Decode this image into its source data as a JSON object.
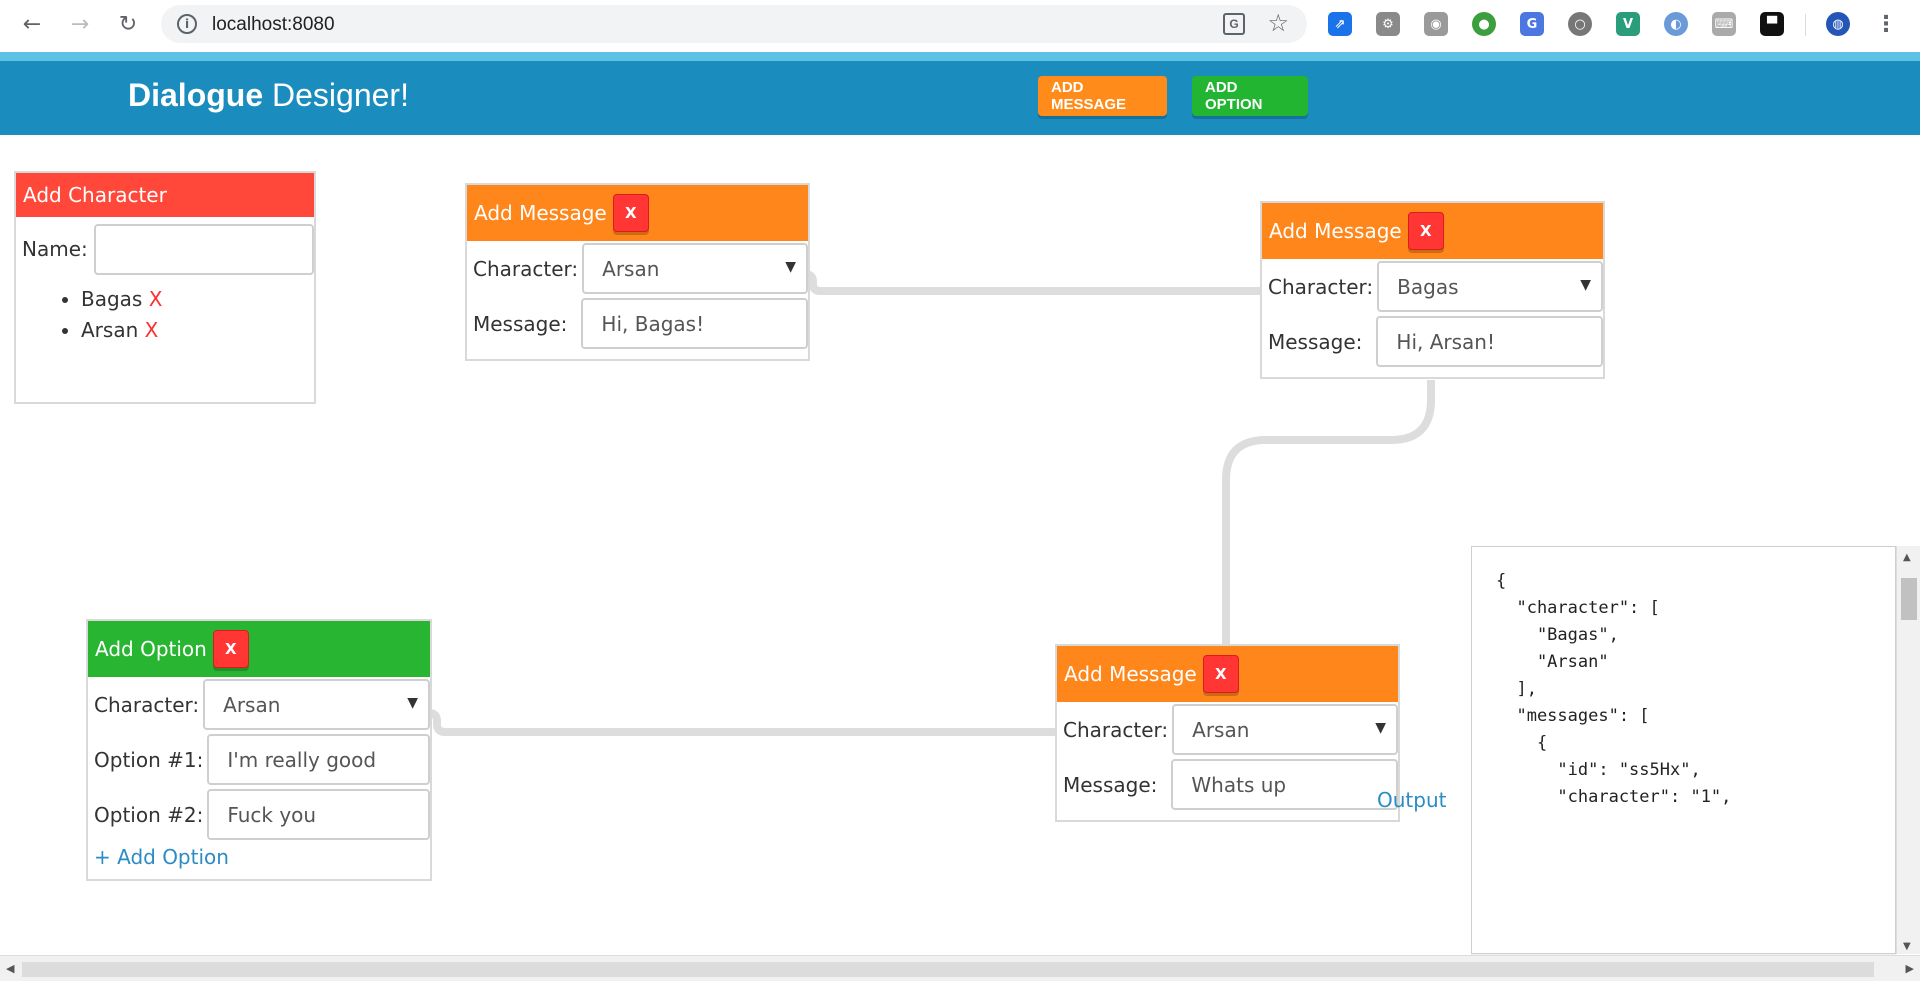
{
  "browser": {
    "url": "localhost:8080",
    "translate_icon": "translate-icon",
    "star_icon": "bookmark-star-icon"
  },
  "header": {
    "title_bold": "Dialogue",
    "title_rest": " Designer!",
    "add_message_label": "ADD MESSAGE",
    "add_option_label": "ADD OPTION"
  },
  "character_panel": {
    "title": "Add Character",
    "name_label": "Name:",
    "name_value": "",
    "characters": [
      "Bagas",
      "Arsan"
    ],
    "delete_label": "X"
  },
  "nodes": {
    "close_label": "X",
    "message1": {
      "title": "Add Message",
      "character_label": "Character:",
      "character": "Arsan",
      "message_label": "Message:",
      "message": "Hi, Bagas!"
    },
    "message2": {
      "title": "Add Message",
      "character_label": "Character:",
      "character": "Bagas",
      "message_label": "Message:",
      "message": "Hi,  Arsan!"
    },
    "message3": {
      "title": "Add Message",
      "character_label": "Character:",
      "character": "Arsan",
      "message_label": "Message:",
      "message": "Whats up"
    },
    "option1": {
      "title": "Add Option",
      "character_label": "Character:",
      "character": "Arsan",
      "option1_label": "Option #1:",
      "option1": "I'm really good",
      "option2_label": "Option #2:",
      "option2": "Fuck you",
      "add_option_label": "+ Add Option"
    }
  },
  "output": {
    "label": "Output",
    "json_lines": [
      "{",
      "  \"character\": [",
      "    \"Bagas\",",
      "    \"Arsan\"",
      "  ],",
      "  \"messages\": [",
      "    {",
      "      \"id\": \"ss5Hx\",",
      "      \"character\": \"1\","
    ]
  },
  "colors": {
    "header": "#1a8cbd",
    "message_node": "#ff861a",
    "option_node": "#28b531",
    "character_node": "#ff473a",
    "close_button": "#ff3633",
    "link": "#2b8cc4"
  }
}
